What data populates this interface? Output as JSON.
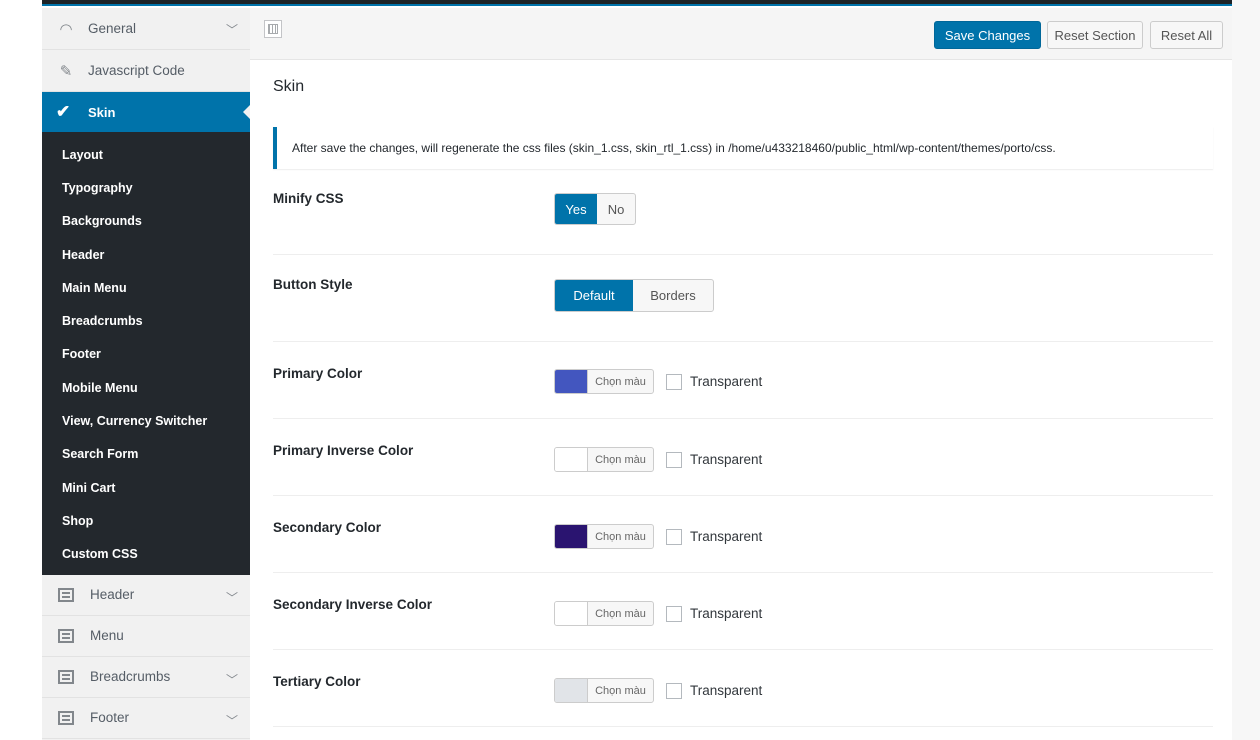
{
  "sidebar": {
    "top_items": [
      {
        "label": "General",
        "icon": "gauge-icon",
        "has_chevron": true
      },
      {
        "label": "Javascript Code",
        "icon": "edit-icon",
        "has_chevron": false
      }
    ],
    "active_item": {
      "label": "Skin",
      "icon": "brush-icon"
    },
    "submenu": [
      "Layout",
      "Typography",
      "Backgrounds",
      "Header",
      "Main Menu",
      "Breadcrumbs",
      "Footer",
      "Mobile Menu",
      "View, Currency Switcher",
      "Search Form",
      "Mini Cart",
      "Shop",
      "Custom CSS"
    ],
    "bottom_items": [
      {
        "label": "Header",
        "icon": "panel-icon",
        "has_chevron": true
      },
      {
        "label": "Menu",
        "icon": "panel-icon",
        "has_chevron": false
      },
      {
        "label": "Breadcrumbs",
        "icon": "panel-icon",
        "has_chevron": true
      },
      {
        "label": "Footer",
        "icon": "panel-icon",
        "has_chevron": true
      }
    ]
  },
  "toolbar": {
    "save_label": "Save Changes",
    "reset_section_label": "Reset Section",
    "reset_all_label": "Reset All"
  },
  "main": {
    "title": "Skin",
    "notice": "After save the changes, will regenerate the css files (skin_1.css, skin_rtl_1.css) in /home/u433218460/public_html/wp-content/themes/porto/css.",
    "minify_css": {
      "label": "Minify CSS",
      "options": [
        "Yes",
        "No"
      ],
      "selected": "Yes"
    },
    "button_style": {
      "label": "Button Style",
      "options": [
        "Default",
        "Borders"
      ],
      "selected": "Default"
    },
    "colors": [
      {
        "label": "Primary Color",
        "value": "#4356bf",
        "button_text": "Chọn màu",
        "checkbox_label": "Transparent",
        "checked": false
      },
      {
        "label": "Primary Inverse Color",
        "value": "#ffffff",
        "button_text": "Chọn màu",
        "checkbox_label": "Transparent",
        "checked": false
      },
      {
        "label": "Secondary Color",
        "value": "#2a1470",
        "button_text": "Chọn màu",
        "checkbox_label": "Transparent",
        "checked": false
      },
      {
        "label": "Secondary Inverse Color",
        "value": "#ffffff",
        "button_text": "Chọn màu",
        "checkbox_label": "Transparent",
        "checked": false
      },
      {
        "label": "Tertiary Color",
        "value": "#e1e4e8",
        "button_text": "Chọn màu",
        "checkbox_label": "Transparent",
        "checked": false
      }
    ]
  },
  "colors": {
    "accent": "#0073aa",
    "sidebar_dark": "#23282d",
    "sidebar_light": "#f1f1f1"
  }
}
